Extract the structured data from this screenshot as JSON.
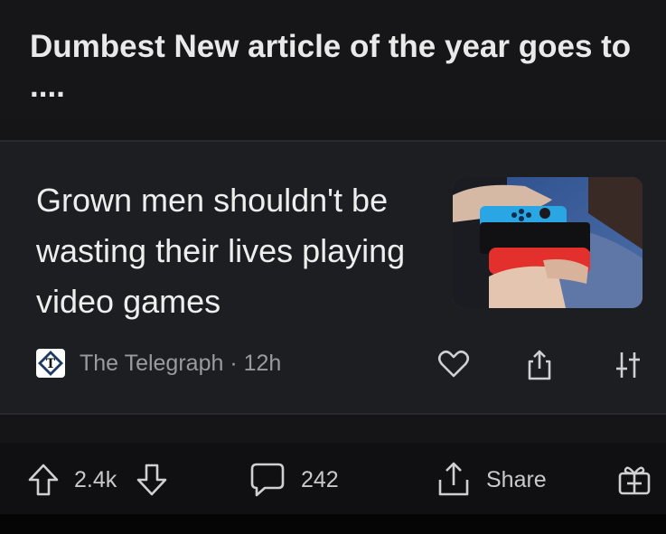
{
  "post": {
    "title": "Dumbest New article of the year goes to ...."
  },
  "article": {
    "headline": "Grown men shouldn't be wasting their lives playing video games",
    "source": "The Telegraph",
    "age": "12h",
    "source_line": "The Telegraph · 12h"
  },
  "actions": {
    "upvotes": "2.4k",
    "comments": "242",
    "share_label": "Share"
  },
  "icons": {
    "source_logo": "telegraph-logo",
    "like": "heart-icon",
    "share_article": "share-up-icon",
    "more": "filter-sliders-icon",
    "upvote": "arrow-up-icon",
    "downvote": "arrow-down-icon",
    "comment": "chat-bubble-icon",
    "share": "share-arrow-icon",
    "award": "gift-icon"
  },
  "colors": {
    "background": "#0b0b0c",
    "card": "#1d1e21",
    "text": "#e6e6e6",
    "muted": "#9a9b9f"
  }
}
